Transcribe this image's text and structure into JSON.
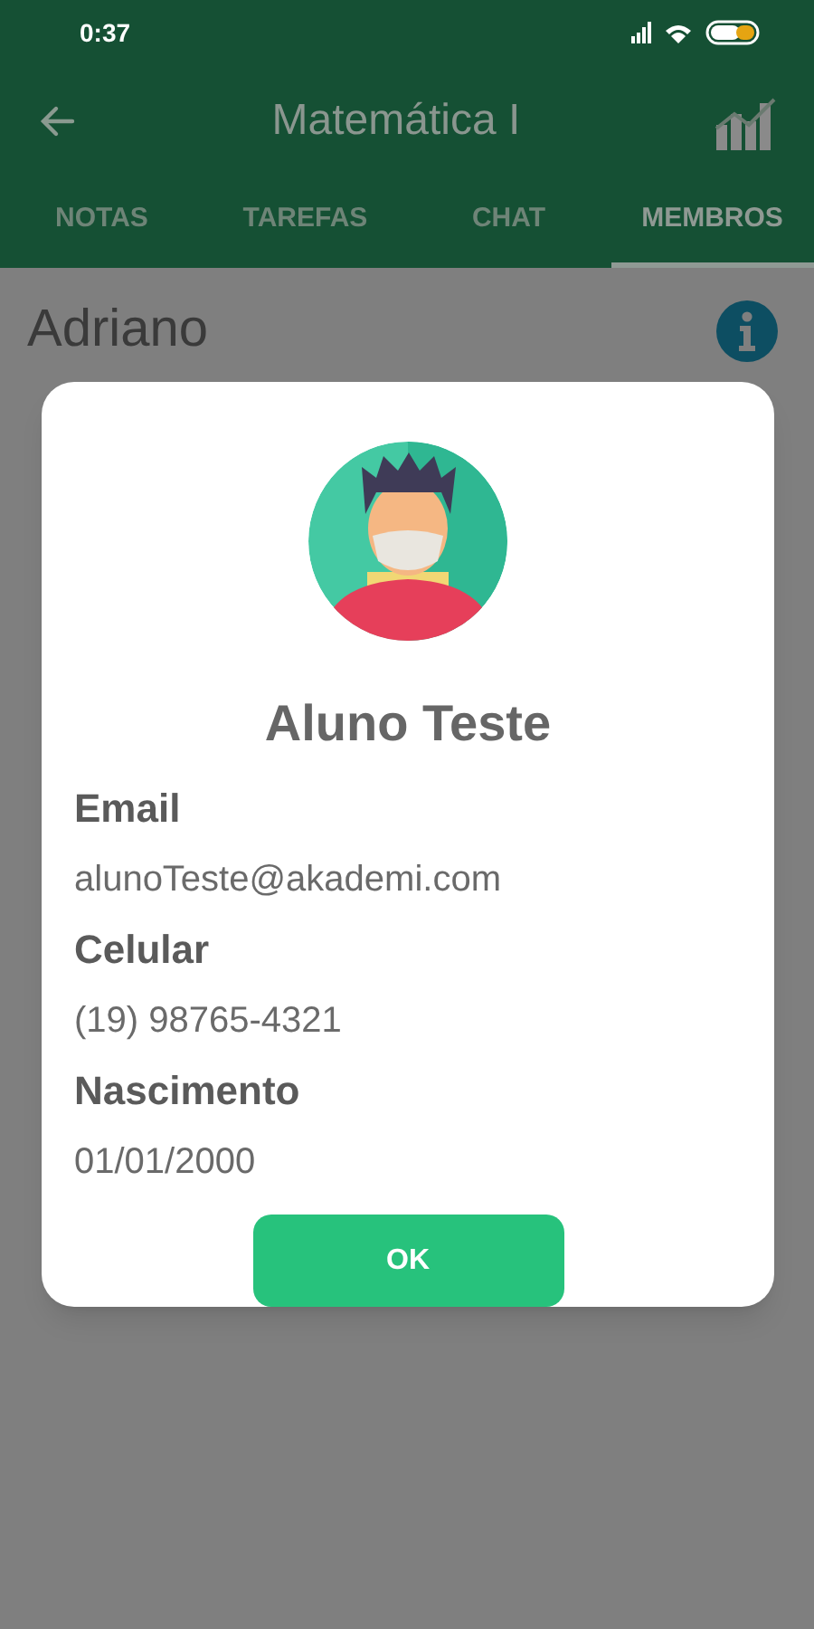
{
  "status_bar": {
    "time": "0:37"
  },
  "app_bar": {
    "title": "Matemática I"
  },
  "tabs": [
    {
      "label": "NOTAS",
      "selected": false
    },
    {
      "label": "TAREFAS",
      "selected": false
    },
    {
      "label": "CHAT",
      "selected": false
    },
    {
      "label": "MEMBROS",
      "selected": true
    }
  ],
  "members": [
    {
      "name": "Adriano"
    }
  ],
  "dialog": {
    "name": "Aluno Teste",
    "fields": [
      {
        "label": "Email",
        "value": "alunoTeste@akademi.com"
      },
      {
        "label": "Celular",
        "value": "(19) 98765-4321"
      },
      {
        "label": "Nascimento",
        "value": "01/01/2000"
      }
    ],
    "button": "OK"
  }
}
